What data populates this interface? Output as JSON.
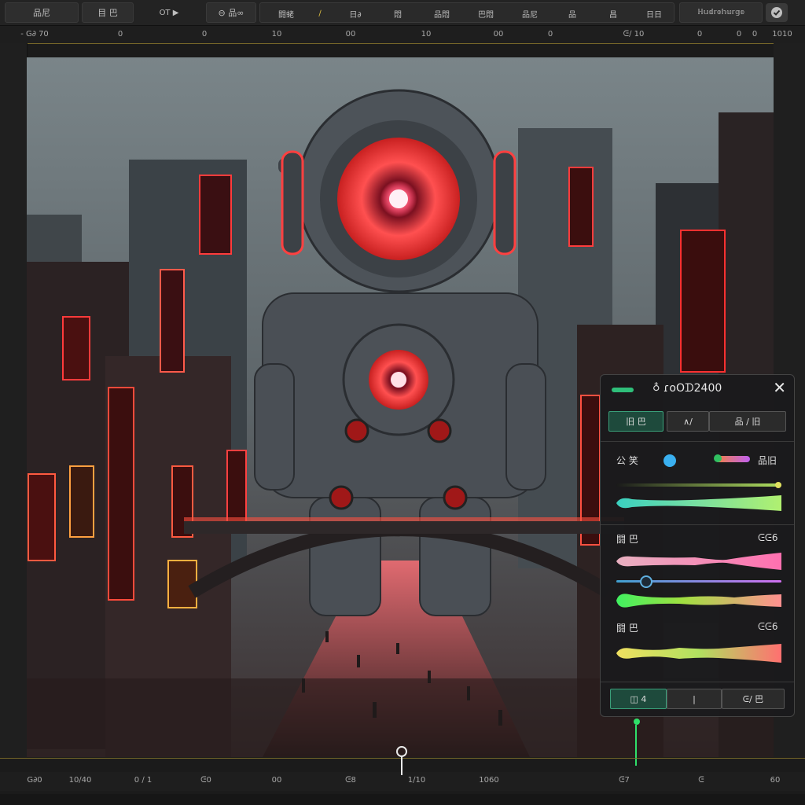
{
  "toolbar": {
    "btn1": "品尼",
    "btn2": "目 巴",
    "btn3": "OT ▶",
    "btn4": "⊖ 品∞",
    "group": [
      "闘蛯",
      "∕",
      "日∂",
      "悶",
      "品悶",
      "巴悶",
      "品尼",
      "品",
      "昌",
      "日日"
    ],
    "search": "ℍ𝕦𝕕𝕣𝕠𝕙𝕦𝕣𝕘𝕠"
  },
  "top_ruler": [
    "- G∂ 70",
    "0",
    "0",
    "10",
    "00",
    "10",
    "00",
    "0",
    "ᕮ∕ 10",
    "0",
    "0",
    "0",
    "1010"
  ],
  "bottom_ruler": [
    "G∂0",
    "10∕40",
    "0 ∕ 1",
    "ᕮ0",
    "00",
    "ᕮ8",
    "1∕10",
    "1060",
    "ᕮ7",
    "ᕮ",
    "60"
  ],
  "panel": {
    "title": "ɾoOᗪ2400",
    "close": "✕",
    "tab1": "旧 巴",
    "tab2": "∧∕",
    "tab3": "品 ∕ 旧",
    "row1_label": "公 笑",
    "row1_value": "品旧",
    "section2_label": "闘 巴",
    "section2_value": "ᕮᕮ6",
    "section3_label": "闘 巴",
    "section3_value": "ᕮᕮ6",
    "footer1": "◫ 4",
    "footer2": "|",
    "footer3": "ᕮ∕ 巴"
  },
  "colors": {
    "accent": "#2fbf7a",
    "panel_bg": "#1a1a1c",
    "neon_red": "#ff3b3b"
  }
}
